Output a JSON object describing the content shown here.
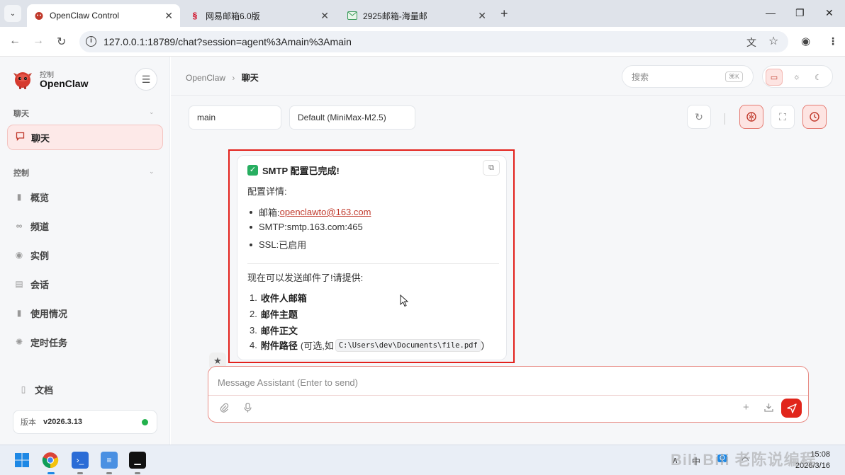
{
  "browser": {
    "tabs": [
      {
        "title": "OpenClaw Control",
        "active": true
      },
      {
        "title": "网易邮箱6.0版",
        "active": false
      },
      {
        "title": "2925邮箱-海量邮",
        "active": false
      }
    ],
    "url": "127.0.0.1:18789/chat?session=agent%3Amain%3Amain"
  },
  "sidebar": {
    "brand_sub": "控制",
    "brand_title": "OpenClaw",
    "section_chat": "聊天",
    "chat_item": "聊天",
    "section_control": "控制",
    "items": [
      {
        "label": "概览",
        "icon": "bar-chart-icon"
      },
      {
        "label": "频道",
        "icon": "link-icon"
      },
      {
        "label": "实例",
        "icon": "radio-icon"
      },
      {
        "label": "会话",
        "icon": "document-icon"
      },
      {
        "label": "使用情况",
        "icon": "bar-chart-icon"
      },
      {
        "label": "定时任务",
        "icon": "sparkle-icon"
      }
    ],
    "docs": "文档",
    "version_label": "版本",
    "version_value": "v2026.3.13"
  },
  "header": {
    "breadcrumb_root": "OpenClaw",
    "breadcrumb_current": "聊天",
    "search_placeholder": "搜索",
    "search_shortcut": "⌘K"
  },
  "toolbar": {
    "session_select": "main",
    "model_select": "Default (MiniMax-M2.5)"
  },
  "message": {
    "title": "SMTP 配置已完成!",
    "details_heading": "配置详情:",
    "details": [
      {
        "label": "邮箱:",
        "value": "openclawto@163.com",
        "link": true
      },
      {
        "label": "SMTP:",
        "value": "smtp.163.com:465",
        "link": false
      },
      {
        "label": "SSL:",
        "value": "已启用",
        "link": false
      }
    ],
    "prompt": "现在可以发送邮件了!请提供:",
    "steps": [
      {
        "num": "1.",
        "label": "收件人邮箱",
        "extra": "",
        "code": ""
      },
      {
        "num": "2.",
        "label": "邮件主题",
        "extra": "",
        "code": ""
      },
      {
        "num": "3.",
        "label": "邮件正文",
        "extra": "",
        "code": ""
      },
      {
        "num": "4.",
        "label": "附件路径",
        "extra": "(可选,如",
        "code": "C:\\Users\\dev\\Documents\\file.pdf",
        "close": ")"
      }
    ]
  },
  "composer": {
    "placeholder": "Message Assistant (Enter to send)"
  },
  "taskbar": {
    "time": "15:08",
    "date": "2026/3/16",
    "lang": "中"
  },
  "watermark": "Bili Bili 老陈说编程"
}
